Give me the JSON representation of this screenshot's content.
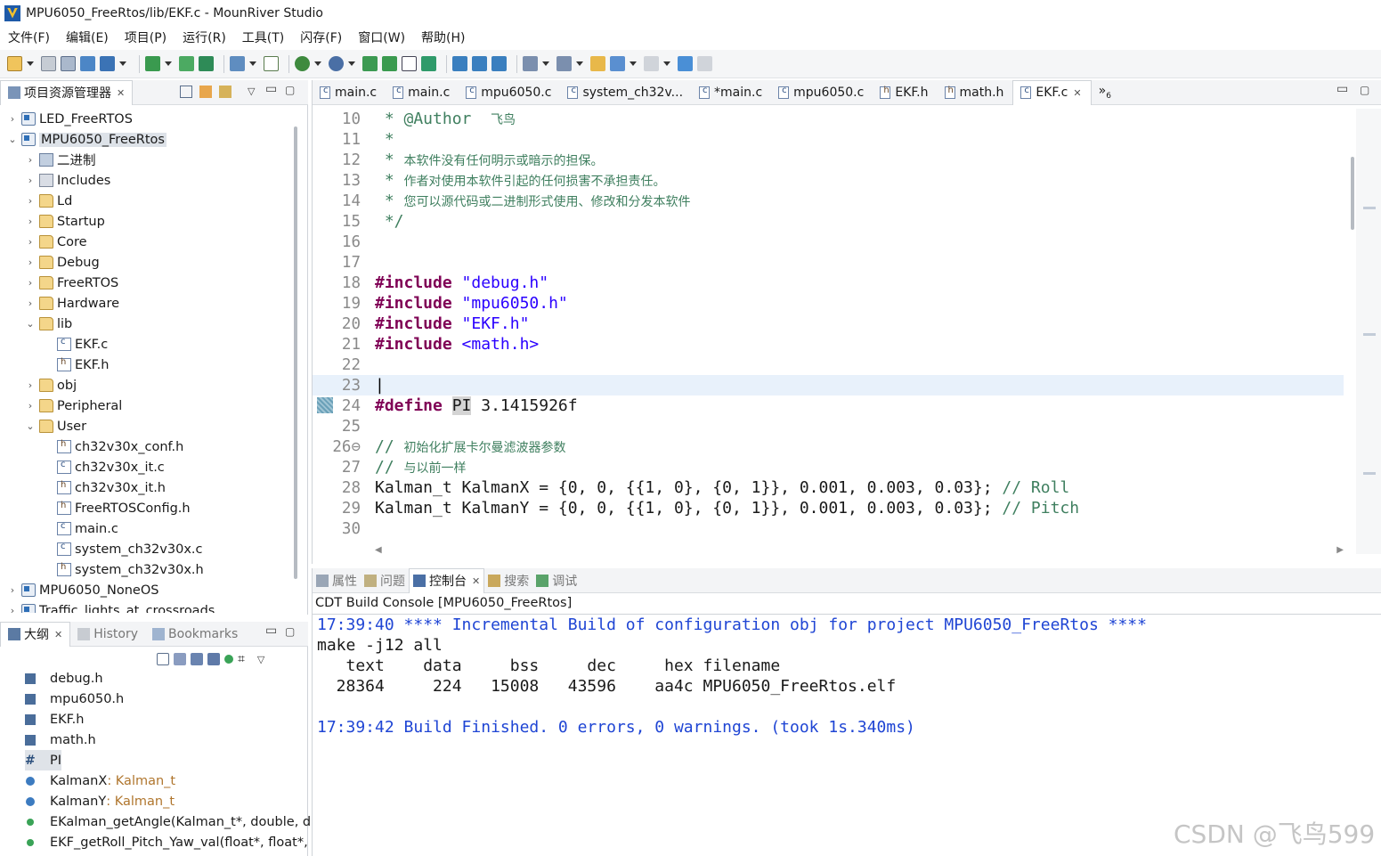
{
  "window": {
    "title": "MPU6050_FreeRtos/lib/EKF.c - MounRiver Studio"
  },
  "menu": [
    "文件(F)",
    "编辑(E)",
    "项目(P)",
    "运行(R)",
    "工具(T)",
    "闪存(F)",
    "窗口(W)",
    "帮助(H)"
  ],
  "explorer": {
    "tab_label": "项目资源管理器",
    "items": [
      {
        "label": "LED_FreeRTOS",
        "indent": 0,
        "arrow": "›",
        "icon": "proj"
      },
      {
        "label": "MPU6050_FreeRtos",
        "indent": 0,
        "arrow": "⌄",
        "icon": "proj",
        "selected": true
      },
      {
        "label": "二进制",
        "indent": 1,
        "arrow": "›",
        "icon": "bin"
      },
      {
        "label": "Includes",
        "indent": 1,
        "arrow": "›",
        "icon": "inc"
      },
      {
        "label": "Ld",
        "indent": 1,
        "arrow": "›",
        "icon": "folder"
      },
      {
        "label": "Startup",
        "indent": 1,
        "arrow": "›",
        "icon": "folder"
      },
      {
        "label": "Core",
        "indent": 1,
        "arrow": "›",
        "icon": "folder"
      },
      {
        "label": "Debug",
        "indent": 1,
        "arrow": "›",
        "icon": "folder"
      },
      {
        "label": "FreeRTOS",
        "indent": 1,
        "arrow": "›",
        "icon": "folder"
      },
      {
        "label": "Hardware",
        "indent": 1,
        "arrow": "›",
        "icon": "folder"
      },
      {
        "label": "lib",
        "indent": 1,
        "arrow": "⌄",
        "icon": "folder"
      },
      {
        "label": "EKF.c",
        "indent": 2,
        "arrow": "",
        "icon": "cfile"
      },
      {
        "label": "EKF.h",
        "indent": 2,
        "arrow": "",
        "icon": "hfile"
      },
      {
        "label": "obj",
        "indent": 1,
        "arrow": "›",
        "icon": "folder"
      },
      {
        "label": "Peripheral",
        "indent": 1,
        "arrow": "›",
        "icon": "folder"
      },
      {
        "label": "User",
        "indent": 1,
        "arrow": "⌄",
        "icon": "folder"
      },
      {
        "label": "ch32v30x_conf.h",
        "indent": 2,
        "arrow": "",
        "icon": "hfile"
      },
      {
        "label": "ch32v30x_it.c",
        "indent": 2,
        "arrow": "",
        "icon": "cfile"
      },
      {
        "label": "ch32v30x_it.h",
        "indent": 2,
        "arrow": "",
        "icon": "hfile"
      },
      {
        "label": "FreeRTOSConfig.h",
        "indent": 2,
        "arrow": "",
        "icon": "hfile"
      },
      {
        "label": "main.c",
        "indent": 2,
        "arrow": "",
        "icon": "cfile"
      },
      {
        "label": "system_ch32v30x.c",
        "indent": 2,
        "arrow": "",
        "icon": "cfile"
      },
      {
        "label": "system_ch32v30x.h",
        "indent": 2,
        "arrow": "",
        "icon": "hfile"
      },
      {
        "label": "MPU6050_NoneOS",
        "indent": 0,
        "arrow": "›",
        "icon": "proj"
      },
      {
        "label": "Traffic_lights_at_crossroads",
        "indent": 0,
        "arrow": "›",
        "icon": "proj"
      }
    ]
  },
  "outline": {
    "tabs": [
      "大纲",
      "History",
      "Bookmarks"
    ],
    "items": [
      {
        "label": "debug.h",
        "type": "",
        "kind": "include"
      },
      {
        "label": "mpu6050.h",
        "type": "",
        "kind": "include"
      },
      {
        "label": "EKF.h",
        "type": "",
        "kind": "include"
      },
      {
        "label": "math.h",
        "type": "",
        "kind": "include"
      },
      {
        "label": "PI",
        "type": "",
        "kind": "macro",
        "selected": true
      },
      {
        "label": "KalmanX",
        "type": " : Kalman_t",
        "kind": "var"
      },
      {
        "label": "KalmanY",
        "type": " : Kalman_t",
        "kind": "var"
      },
      {
        "label": "EKalman_getAngle(Kalman_t*, double, d",
        "type": "",
        "kind": "func"
      },
      {
        "label": "EKF_getRoll_Pitch_Yaw_val(float*, float*,",
        "type": "",
        "kind": "func"
      }
    ]
  },
  "editor": {
    "tabs": [
      {
        "label": "main.c",
        "icon": "cfile"
      },
      {
        "label": "main.c",
        "icon": "cfile"
      },
      {
        "label": "mpu6050.c",
        "icon": "cfile"
      },
      {
        "label": "system_ch32v...",
        "icon": "cfile"
      },
      {
        "label": "*main.c",
        "icon": "cfile"
      },
      {
        "label": "mpu6050.c",
        "icon": "cfile"
      },
      {
        "label": "EKF.h",
        "icon": "hfile"
      },
      {
        "label": "math.h",
        "icon": "hfile"
      },
      {
        "label": "EKF.c",
        "icon": "cfile",
        "active": true
      }
    ],
    "overflow_label": "»",
    "overflow_count": "6",
    "lines": [
      {
        "n": "10",
        "parts": [
          {
            "t": " * @Author  ",
            "c": "cmt"
          },
          {
            "t": "飞鸟",
            "c": "cmt-cn"
          }
        ]
      },
      {
        "n": "11",
        "parts": [
          {
            "t": " *",
            "c": "cmt"
          }
        ]
      },
      {
        "n": "12",
        "parts": [
          {
            "t": " * ",
            "c": "cmt"
          },
          {
            "t": "本软件没有任何明示或暗示的担保。",
            "c": "cmt-cn"
          }
        ]
      },
      {
        "n": "13",
        "parts": [
          {
            "t": " * ",
            "c": "cmt"
          },
          {
            "t": "作者对使用本软件引起的任何损害不承担责任。",
            "c": "cmt-cn"
          }
        ]
      },
      {
        "n": "14",
        "parts": [
          {
            "t": " * ",
            "c": "cmt"
          },
          {
            "t": "您可以源代码或二进制形式使用、修改和分发本软件",
            "c": "cmt-cn"
          }
        ]
      },
      {
        "n": "15",
        "parts": [
          {
            "t": " */",
            "c": "cmt"
          }
        ]
      },
      {
        "n": "16",
        "parts": []
      },
      {
        "n": "17",
        "parts": []
      },
      {
        "n": "18",
        "parts": [
          {
            "t": "#include",
            "c": "kw"
          },
          {
            "t": " ",
            "c": ""
          },
          {
            "t": "\"debug.h\"",
            "c": "str"
          }
        ]
      },
      {
        "n": "19",
        "parts": [
          {
            "t": "#include",
            "c": "kw"
          },
          {
            "t": " ",
            "c": ""
          },
          {
            "t": "\"mpu6050.h\"",
            "c": "str"
          }
        ]
      },
      {
        "n": "20",
        "parts": [
          {
            "t": "#include",
            "c": "kw"
          },
          {
            "t": " ",
            "c": ""
          },
          {
            "t": "\"EKF.h\"",
            "c": "str"
          }
        ]
      },
      {
        "n": "21",
        "parts": [
          {
            "t": "#include",
            "c": "kw"
          },
          {
            "t": " ",
            "c": ""
          },
          {
            "t": "<math.h>",
            "c": "str"
          }
        ]
      },
      {
        "n": "22",
        "parts": []
      },
      {
        "n": "23",
        "parts": [
          {
            "t": "|",
            "c": ""
          }
        ],
        "current": true
      },
      {
        "n": "24",
        "parts": [
          {
            "t": "#define",
            "c": "kw"
          },
          {
            "t": " ",
            "c": ""
          },
          {
            "t": "PI",
            "c": "hl"
          },
          {
            "t": " 3.1415926f",
            "c": ""
          }
        ],
        "marker": true
      },
      {
        "n": "25",
        "parts": []
      },
      {
        "n": "26⊖",
        "parts": [
          {
            "t": "// ",
            "c": "cmt"
          },
          {
            "t": "初始化扩展卡尔曼滤波器参数",
            "c": "cmt-cn"
          }
        ]
      },
      {
        "n": "27",
        "parts": [
          {
            "t": "// ",
            "c": "cmt"
          },
          {
            "t": "与以前一样",
            "c": "cmt-cn"
          }
        ]
      },
      {
        "n": "28",
        "parts": [
          {
            "t": "Kalman_t KalmanX = {0, 0, {{1, 0}, {0, 1}}, 0.001, 0.003, 0.03}; ",
            "c": ""
          },
          {
            "t": "// Roll",
            "c": "cmt"
          }
        ]
      },
      {
        "n": "29",
        "parts": [
          {
            "t": "Kalman_t KalmanY = {0, 0, {{1, 0}, {0, 1}}, 0.001, 0.003, 0.03}; ",
            "c": ""
          },
          {
            "t": "// Pitch",
            "c": "cmt"
          }
        ]
      },
      {
        "n": "30",
        "parts": []
      }
    ]
  },
  "console": {
    "tabs": [
      {
        "label": "属性",
        "active": false
      },
      {
        "label": "问题",
        "active": false
      },
      {
        "label": "控制台",
        "active": true
      },
      {
        "label": "搜索",
        "active": false
      },
      {
        "label": "调试",
        "active": false
      }
    ],
    "title": "CDT Build Console [MPU6050_FreeRtos]",
    "lines": [
      {
        "text": "17:39:40 **** Incremental Build of configuration obj for project MPU6050_FreeRtos ****",
        "color": "blue"
      },
      {
        "text": "make -j12 all",
        "color": "black"
      },
      {
        "text": "   text    data     bss     dec     hex filename",
        "color": "black"
      },
      {
        "text": "  28364     224   15008   43596    aa4c MPU6050_FreeRtos.elf",
        "color": "black"
      },
      {
        "text": "",
        "color": "black"
      },
      {
        "text": "17:39:42 Build Finished. 0 errors, 0 warnings. (took 1s.340ms)",
        "color": "blue"
      }
    ]
  },
  "watermark": "CSDN @飞鸟599",
  "colors": {
    "keyword": "#7f0055",
    "string": "#2a00ff",
    "comment": "#3f7f5f",
    "console_blue": "#1f45d4"
  }
}
